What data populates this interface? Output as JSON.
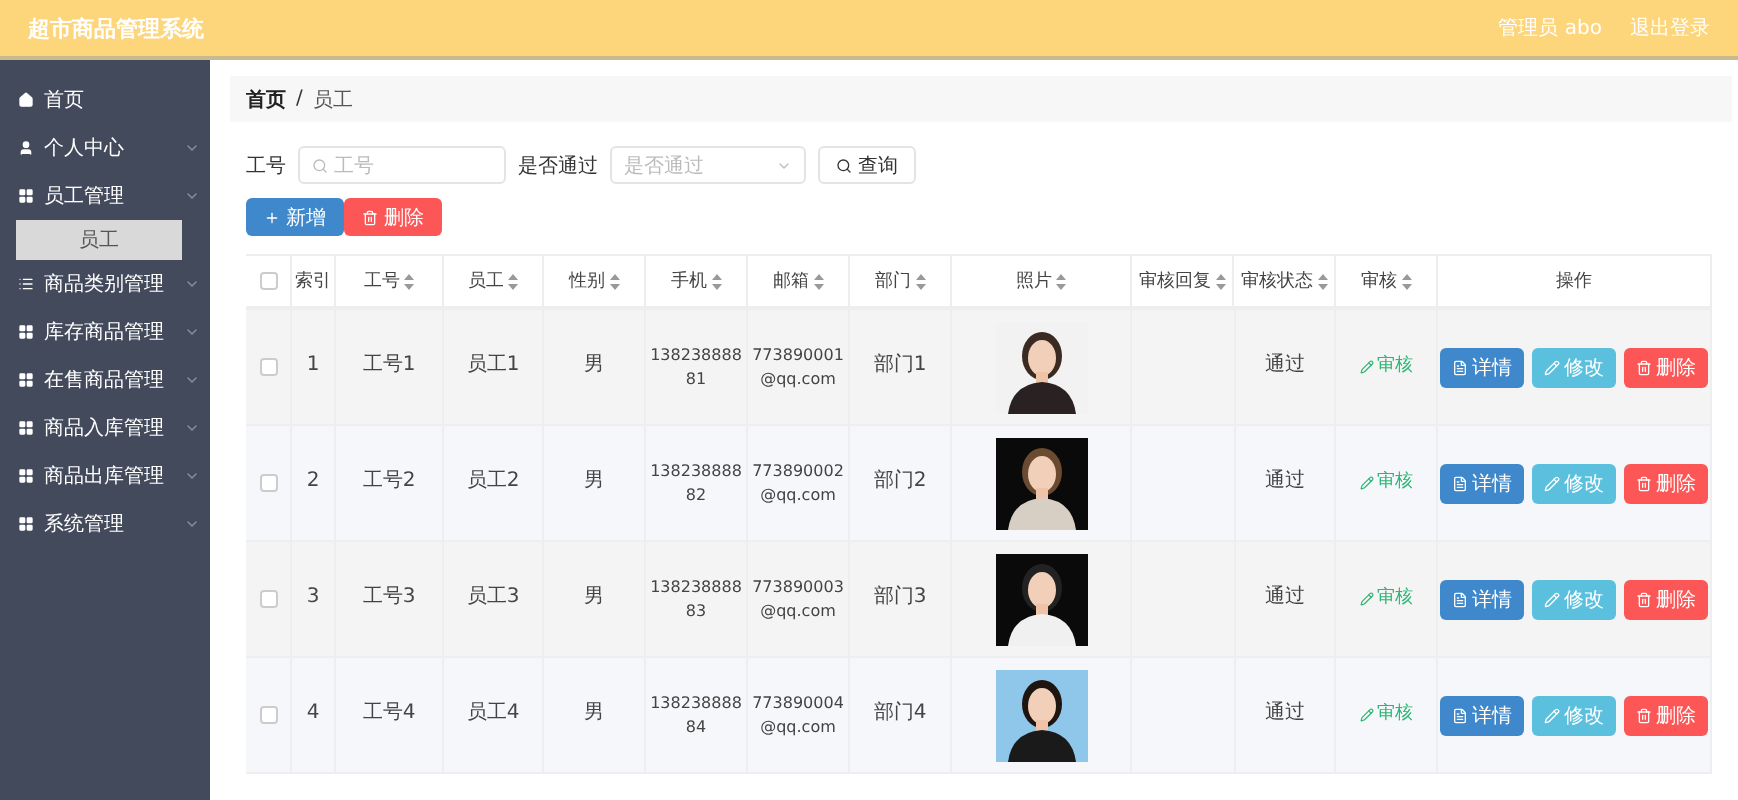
{
  "header": {
    "title": "超市商品管理系统",
    "user": "管理员 abo",
    "logout": "退出登录"
  },
  "sidebar": {
    "items": [
      {
        "label": "首页",
        "submenu": false,
        "selected": false
      },
      {
        "label": "个人中心",
        "submenu": true,
        "selected": false
      },
      {
        "label": "员工管理",
        "submenu": true,
        "selected": false,
        "children": [
          {
            "label": "员工",
            "selected": true
          }
        ]
      },
      {
        "label": "商品类别管理",
        "submenu": true,
        "selected": false
      },
      {
        "label": "库存商品管理",
        "submenu": true,
        "selected": false
      },
      {
        "label": "在售商品管理",
        "submenu": true,
        "selected": false
      },
      {
        "label": "商品入库管理",
        "submenu": true,
        "selected": false
      },
      {
        "label": "商品出库管理",
        "submenu": true,
        "selected": false
      },
      {
        "label": "系统管理",
        "submenu": true,
        "selected": false
      }
    ]
  },
  "breadcrumb": [
    "首页",
    "员工"
  ],
  "breadcrumb_separator": "/",
  "search": {
    "field_label": "工号",
    "field_placeholder": "工号",
    "select_label": "是否通过",
    "select_placeholder": "是否通过",
    "button": "查询"
  },
  "actions": {
    "add": "新增",
    "delete": "删除"
  },
  "table": {
    "select_all_checked": false,
    "columns": [
      {
        "label": "索引",
        "sortable": false
      },
      {
        "label": "工号",
        "sortable": true
      },
      {
        "label": "员工",
        "sortable": true
      },
      {
        "label": "性别",
        "sortable": true
      },
      {
        "label": "手机",
        "sortable": true
      },
      {
        "label": "邮箱",
        "sortable": true
      },
      {
        "label": "部门",
        "sortable": true
      },
      {
        "label": "照片",
        "sortable": true
      },
      {
        "label": "审核回复",
        "sortable": true
      },
      {
        "label": "审核状态",
        "sortable": true
      },
      {
        "label": "审核",
        "sortable": true
      },
      {
        "label": "操作",
        "sortable": false
      }
    ],
    "rows": [
      {
        "checked": false,
        "index": "1",
        "id": "工号1",
        "name": "员工1",
        "gender": "男",
        "phone": "13823888881",
        "email": "773890001@qq.com",
        "dept": "部门1",
        "photo": {
          "kind": "picture"
        },
        "status": "通过",
        "review": "审核",
        "buttons": [
          "详情",
          "修改",
          "删除"
        ]
      },
      {
        "checked": false,
        "index": "2",
        "id": "工号2",
        "name": "员工2",
        "gender": "男",
        "phone": "13823888882",
        "email": "773890002@qq.com",
        "dept": "部门2",
        "photo": {
          "kind": "picture"
        },
        "status": "通过",
        "review": "审核",
        "buttons": [
          "详情",
          "修改",
          "删除"
        ]
      },
      {
        "checked": false,
        "index": "3",
        "id": "工号3",
        "name": "员工3",
        "gender": "男",
        "phone": "13823888883",
        "email": "773890003@qq.com",
        "dept": "部门3",
        "photo": {
          "kind": "picture"
        },
        "status": "通过",
        "review": "审核",
        "buttons": [
          "详情",
          "修改",
          "删除"
        ]
      },
      {
        "checked": false,
        "index": "4",
        "id": "工号4",
        "name": "员工4",
        "gender": "男",
        "phone": "13823888884",
        "email": "773890004@qq.com",
        "dept": "部门4",
        "photo": {
          "kind": "picture"
        },
        "status": "通过",
        "review": "审核",
        "buttons": [
          "详情",
          "修改",
          "删除"
        ]
      }
    ]
  }
}
